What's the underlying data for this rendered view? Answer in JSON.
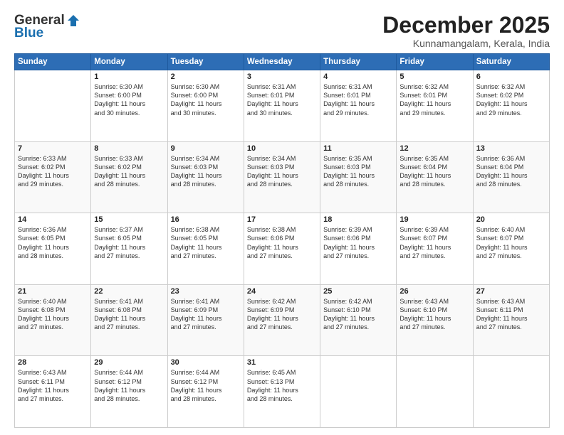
{
  "logo": {
    "general": "General",
    "blue": "Blue"
  },
  "header": {
    "month": "December 2025",
    "location": "Kunnamangalam, Kerala, India"
  },
  "weekdays": [
    "Sunday",
    "Monday",
    "Tuesday",
    "Wednesday",
    "Thursday",
    "Friday",
    "Saturday"
  ],
  "weeks": [
    [
      {
        "day": "",
        "info": ""
      },
      {
        "day": "1",
        "info": "Sunrise: 6:30 AM\nSunset: 6:00 PM\nDaylight: 11 hours\nand 30 minutes."
      },
      {
        "day": "2",
        "info": "Sunrise: 6:30 AM\nSunset: 6:00 PM\nDaylight: 11 hours\nand 30 minutes."
      },
      {
        "day": "3",
        "info": "Sunrise: 6:31 AM\nSunset: 6:01 PM\nDaylight: 11 hours\nand 30 minutes."
      },
      {
        "day": "4",
        "info": "Sunrise: 6:31 AM\nSunset: 6:01 PM\nDaylight: 11 hours\nand 29 minutes."
      },
      {
        "day": "5",
        "info": "Sunrise: 6:32 AM\nSunset: 6:01 PM\nDaylight: 11 hours\nand 29 minutes."
      },
      {
        "day": "6",
        "info": "Sunrise: 6:32 AM\nSunset: 6:02 PM\nDaylight: 11 hours\nand 29 minutes."
      }
    ],
    [
      {
        "day": "7",
        "info": "Sunrise: 6:33 AM\nSunset: 6:02 PM\nDaylight: 11 hours\nand 29 minutes."
      },
      {
        "day": "8",
        "info": "Sunrise: 6:33 AM\nSunset: 6:02 PM\nDaylight: 11 hours\nand 28 minutes."
      },
      {
        "day": "9",
        "info": "Sunrise: 6:34 AM\nSunset: 6:03 PM\nDaylight: 11 hours\nand 28 minutes."
      },
      {
        "day": "10",
        "info": "Sunrise: 6:34 AM\nSunset: 6:03 PM\nDaylight: 11 hours\nand 28 minutes."
      },
      {
        "day": "11",
        "info": "Sunrise: 6:35 AM\nSunset: 6:03 PM\nDaylight: 11 hours\nand 28 minutes."
      },
      {
        "day": "12",
        "info": "Sunrise: 6:35 AM\nSunset: 6:04 PM\nDaylight: 11 hours\nand 28 minutes."
      },
      {
        "day": "13",
        "info": "Sunrise: 6:36 AM\nSunset: 6:04 PM\nDaylight: 11 hours\nand 28 minutes."
      }
    ],
    [
      {
        "day": "14",
        "info": "Sunrise: 6:36 AM\nSunset: 6:05 PM\nDaylight: 11 hours\nand 28 minutes."
      },
      {
        "day": "15",
        "info": "Sunrise: 6:37 AM\nSunset: 6:05 PM\nDaylight: 11 hours\nand 27 minutes."
      },
      {
        "day": "16",
        "info": "Sunrise: 6:38 AM\nSunset: 6:05 PM\nDaylight: 11 hours\nand 27 minutes."
      },
      {
        "day": "17",
        "info": "Sunrise: 6:38 AM\nSunset: 6:06 PM\nDaylight: 11 hours\nand 27 minutes."
      },
      {
        "day": "18",
        "info": "Sunrise: 6:39 AM\nSunset: 6:06 PM\nDaylight: 11 hours\nand 27 minutes."
      },
      {
        "day": "19",
        "info": "Sunrise: 6:39 AM\nSunset: 6:07 PM\nDaylight: 11 hours\nand 27 minutes."
      },
      {
        "day": "20",
        "info": "Sunrise: 6:40 AM\nSunset: 6:07 PM\nDaylight: 11 hours\nand 27 minutes."
      }
    ],
    [
      {
        "day": "21",
        "info": "Sunrise: 6:40 AM\nSunset: 6:08 PM\nDaylight: 11 hours\nand 27 minutes."
      },
      {
        "day": "22",
        "info": "Sunrise: 6:41 AM\nSunset: 6:08 PM\nDaylight: 11 hours\nand 27 minutes."
      },
      {
        "day": "23",
        "info": "Sunrise: 6:41 AM\nSunset: 6:09 PM\nDaylight: 11 hours\nand 27 minutes."
      },
      {
        "day": "24",
        "info": "Sunrise: 6:42 AM\nSunset: 6:09 PM\nDaylight: 11 hours\nand 27 minutes."
      },
      {
        "day": "25",
        "info": "Sunrise: 6:42 AM\nSunset: 6:10 PM\nDaylight: 11 hours\nand 27 minutes."
      },
      {
        "day": "26",
        "info": "Sunrise: 6:43 AM\nSunset: 6:10 PM\nDaylight: 11 hours\nand 27 minutes."
      },
      {
        "day": "27",
        "info": "Sunrise: 6:43 AM\nSunset: 6:11 PM\nDaylight: 11 hours\nand 27 minutes."
      }
    ],
    [
      {
        "day": "28",
        "info": "Sunrise: 6:43 AM\nSunset: 6:11 PM\nDaylight: 11 hours\nand 27 minutes."
      },
      {
        "day": "29",
        "info": "Sunrise: 6:44 AM\nSunset: 6:12 PM\nDaylight: 11 hours\nand 28 minutes."
      },
      {
        "day": "30",
        "info": "Sunrise: 6:44 AM\nSunset: 6:12 PM\nDaylight: 11 hours\nand 28 minutes."
      },
      {
        "day": "31",
        "info": "Sunrise: 6:45 AM\nSunset: 6:13 PM\nDaylight: 11 hours\nand 28 minutes."
      },
      {
        "day": "",
        "info": ""
      },
      {
        "day": "",
        "info": ""
      },
      {
        "day": "",
        "info": ""
      }
    ]
  ]
}
